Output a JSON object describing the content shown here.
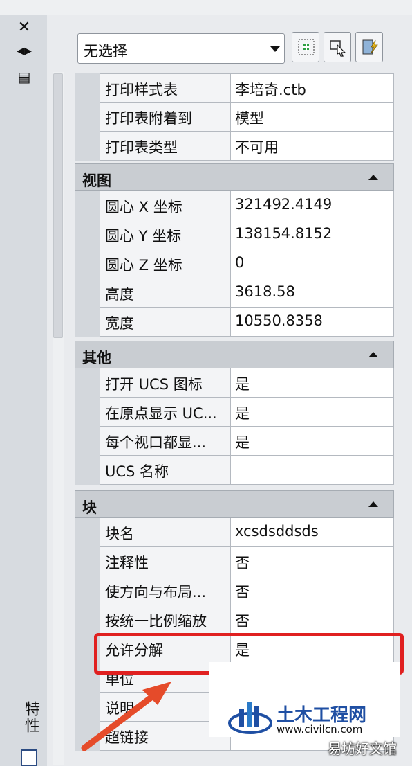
{
  "panel": {
    "title": "特性",
    "selector_value": "无选择",
    "close_icon": "close-icon",
    "collapse_icon": "collapse-icon"
  },
  "sections": [
    {
      "rows": [
        {
          "name": "打印样式表",
          "value": "李培奇.ctb"
        },
        {
          "name": "打印表附着到",
          "value": "模型"
        },
        {
          "name": "打印表类型",
          "value": "不可用"
        }
      ]
    },
    {
      "title": "视图",
      "rows": [
        {
          "name": "圆心 X 坐标",
          "value": "321492.4149"
        },
        {
          "name": "圆心 Y 坐标",
          "value": "138154.8152"
        },
        {
          "name": "圆心 Z 坐标",
          "value": "0"
        },
        {
          "name": "高度",
          "value": "3618.58"
        },
        {
          "name": "宽度",
          "value": "10550.8358"
        }
      ]
    },
    {
      "title": "其他",
      "rows": [
        {
          "name": "打开 UCS 图标",
          "value": "是"
        },
        {
          "name": "在原点显示 UC...",
          "value": "是"
        },
        {
          "name": "每个视口都显...",
          "value": "是"
        },
        {
          "name": "UCS 名称",
          "value": ""
        }
      ]
    },
    {
      "title": "块",
      "rows": [
        {
          "name": "块名",
          "value": "xcsdsddsds"
        },
        {
          "name": "注释性",
          "value": "否"
        },
        {
          "name": "使方向与布局...",
          "value": "否"
        },
        {
          "name": "按统一比例缩放",
          "value": "否"
        },
        {
          "name": "允许分解",
          "value": "是"
        },
        {
          "name": "单位",
          "value": ""
        },
        {
          "name": "说明",
          "value": ""
        },
        {
          "name": "超链接",
          "value": ""
        }
      ]
    }
  ],
  "watermark": {
    "brand": "土木工程网",
    "url": "www.civilcn.com",
    "site": "易坊好文馆"
  },
  "colors": {
    "highlight": "#e02020",
    "brand_blue": "#1f4fa3"
  }
}
